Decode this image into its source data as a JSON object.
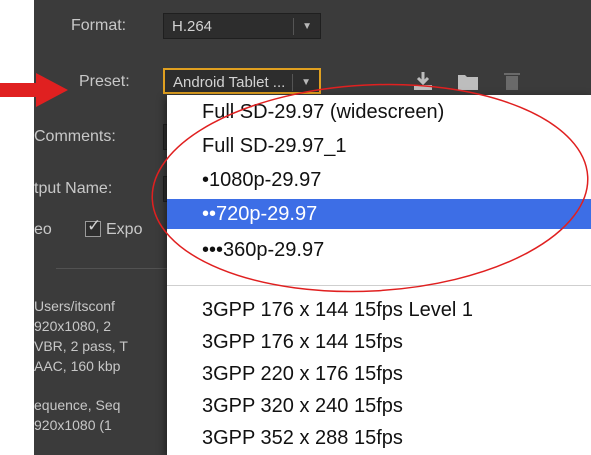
{
  "panel": {
    "format_label": "Format:",
    "format_value": "H.264",
    "preset_label": "Preset:",
    "preset_value": "Android Tablet ...",
    "comments_label": "Comments:",
    "output_name_label": "tput Name:",
    "video_label": "eo",
    "export_checkbox_label": "Expo",
    "summary_lines": [
      "Users/itsconf",
      "920x1080, 2",
      "VBR, 2 pass, T",
      "AAC, 160 kbp",
      "equence, Seq",
      "920x1080 (1"
    ]
  },
  "preset_menu": {
    "items": [
      "Full SD-29.97 (widescreen)",
      "Full SD-29.97_1",
      "•1080p-29.97",
      "••720p-29.97",
      "•••360p-29.97"
    ],
    "selected_index": 3,
    "items_3gpp": [
      "3GPP 176 x 144 15fps Level 1",
      "3GPP 176 x 144 15fps",
      "3GPP 220 x 176 15fps",
      "3GPP 320 x 240 15fps",
      "3GPP 352 x 288 15fps"
    ]
  },
  "colors": {
    "panel_bg": "#3b3b3b",
    "selection": "#3d6ee6",
    "annotation_red": "#e02020",
    "preset_border": "#e0a020"
  },
  "icons": [
    "import-preset-icon",
    "save-preset-icon",
    "delete-preset-icon",
    "dropdown-caret-icon"
  ]
}
